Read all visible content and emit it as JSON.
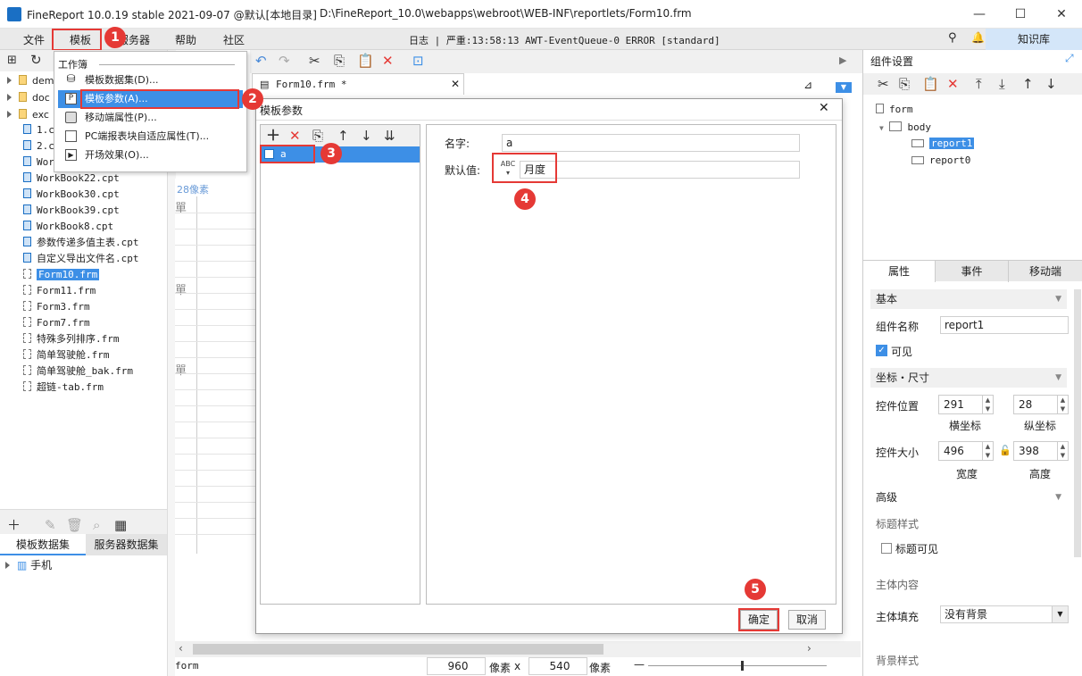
{
  "window": {
    "title": "FineReport 10.0.19 stable 2021-09-07 @默认[本地目录]",
    "path": "D:\\FineReport_10.0\\webapps\\webroot\\WEB-INF\\reportlets/Form10.frm",
    "controls": [
      "—",
      "☐",
      "✕"
    ]
  },
  "menubar": {
    "items": [
      "文件",
      "模板",
      "服务器",
      "帮助",
      "社区"
    ],
    "log": "日志 | 严重:13:58:13 AWT-EventQueue-0 ERROR [standard]",
    "knowledge": "知识库"
  },
  "dropdown": {
    "section": "工作簿",
    "items": [
      "模板数据集(D)...",
      "模板参数(A)...",
      "移动端属性(P)...",
      "PC端报表块自适应属性(T)...",
      "开场效果(O)..."
    ]
  },
  "filetree": {
    "folders": [
      "dem",
      "doc",
      "exc"
    ],
    "files": [
      "1.c",
      "2.c",
      "Wor",
      "WorkBook22.cpt",
      "WorkBook30.cpt",
      "WorkBook39.cpt",
      "WorkBook8.cpt",
      "参数传递多值主表.cpt",
      "自定义导出文件名.cpt",
      "Form10.frm",
      "Form11.frm",
      "Form3.frm",
      "Form7.frm",
      "特殊多列排序.frm",
      "简单驾驶舱.frm",
      "简单驾驶舱_bak.frm",
      "超链-tab.frm"
    ]
  },
  "bottom_left": {
    "tabs": [
      "模板数据集",
      "服务器数据集"
    ],
    "item": "手机"
  },
  "editor": {
    "tab": "Form10.frm *",
    "ruler": "28像素",
    "status": {
      "label": "form",
      "width": "960",
      "unit1": "像素",
      "x": "x",
      "height": "540",
      "unit2": "像素"
    },
    "cells": [
      "單",
      "單",
      "單"
    ]
  },
  "dialog": {
    "title": "模板参数",
    "param": "a",
    "name_label": "名字:",
    "name_value": "a",
    "default_label": "默认值:",
    "default_value": "月度",
    "ok": "确定",
    "cancel": "取消"
  },
  "badges": [
    "1",
    "2",
    "3",
    "4",
    "5"
  ],
  "right_panel": {
    "title": "组件设置",
    "tree": [
      "form",
      "body",
      "report1",
      "report0"
    ],
    "tabs": [
      "属性",
      "事件",
      "移动端"
    ],
    "basic": "基本",
    "name_label": "组件名称",
    "name_value": "report1",
    "visible": "可见",
    "coord": "坐标・尺寸",
    "pos_label": "控件位置",
    "x": "291",
    "y": "28",
    "x_label": "横坐标",
    "y_label": "纵坐标",
    "size_label": "控件大小",
    "w": "496",
    "h": "398",
    "w_label": "宽度",
    "h_label": "高度",
    "advanced": "高级",
    "title_style": "标题样式",
    "title_visible": "标题可见",
    "body_content": "主体内容",
    "fill_label": "主体填充",
    "fill_value": "没有背景",
    "bg_style": "背景样式"
  },
  "colors": {
    "accent": "#3d8fe6",
    "highlight_red": "#e53935"
  }
}
